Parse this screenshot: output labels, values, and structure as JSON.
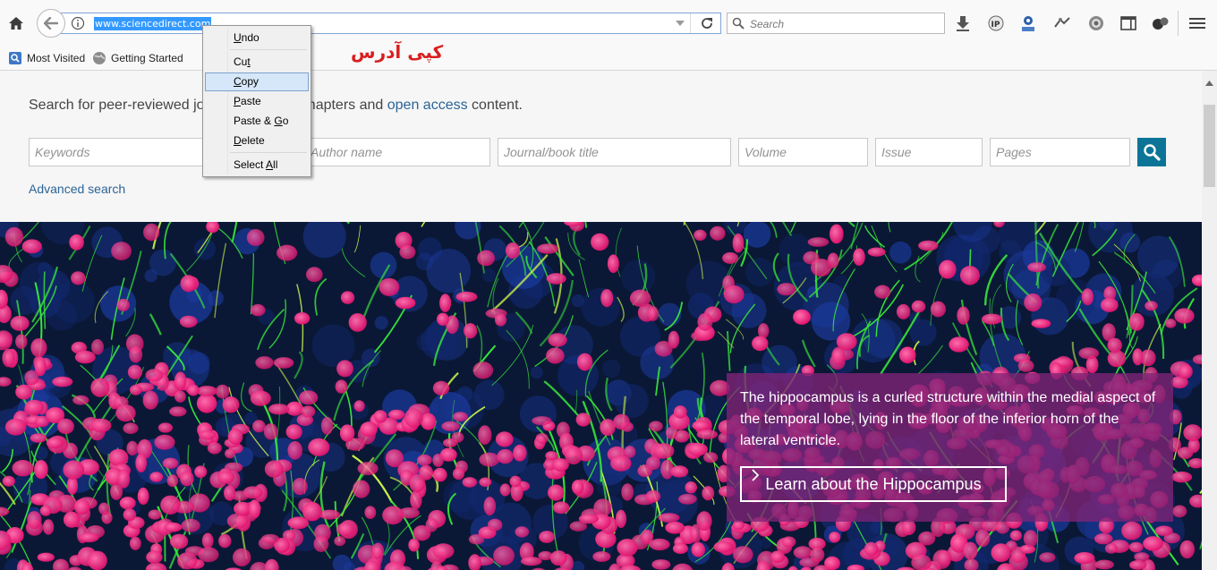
{
  "browser": {
    "url": "www.sciencedirect.com",
    "search_placeholder": "Search",
    "bookmarks": [
      "Most Visited",
      "Getting Started"
    ],
    "extension_icons": [
      "ip-address-icon",
      "extension-icon",
      "extension-icon",
      "gear-icon",
      "sidebar-icon",
      "extension-icon"
    ]
  },
  "context_menu": {
    "items": [
      {
        "pre": "",
        "key": "U",
        "post": "ndo"
      },
      {
        "pre": "Cu",
        "key": "t",
        "post": ""
      },
      {
        "pre": "",
        "key": "C",
        "post": "opy"
      },
      {
        "pre": "",
        "key": "P",
        "post": "aste"
      },
      {
        "pre": "Paste & ",
        "key": "G",
        "post": "o"
      },
      {
        "pre": "",
        "key": "D",
        "post": "elete"
      },
      {
        "pre": "Select ",
        "key": "A",
        "post": "ll"
      }
    ],
    "highlighted": "Copy"
  },
  "annotation": "کپی آدرس",
  "page": {
    "intro_pre": "Search for peer-reviewed jo",
    "intro_mid": "ook chapters and ",
    "intro_link": "open access",
    "intro_post": " content.",
    "fields": {
      "keywords": "Keywords",
      "author": "Author name",
      "journal": "Journal/book title",
      "volume": "Volume",
      "issue": "Issue",
      "pages": "Pages"
    },
    "advanced_search": "Advanced search",
    "hero": {
      "caption": "The hippocampus is a curled structure within the medial aspect of the temporal lobe, lying in the floor of the inferior horn of the lateral ventricle.",
      "button": "Learn about the Hippocampus"
    }
  },
  "colors": {
    "accent_teal": "#0c7597",
    "link_blue": "#2a6496",
    "url_selection": "#3399ff",
    "hero_card": "#802476",
    "annotation_red": "#d91e1e"
  }
}
